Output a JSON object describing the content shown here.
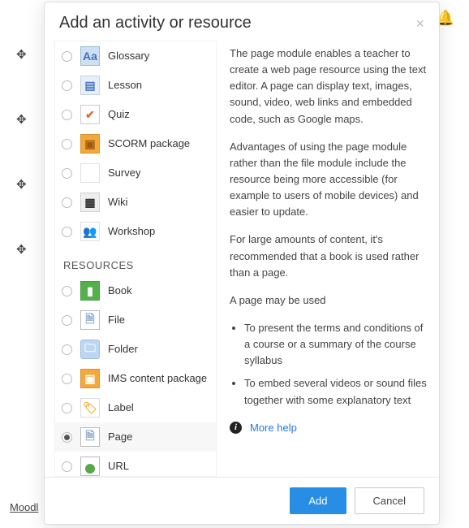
{
  "header": {
    "title": "Add an activity or resource"
  },
  "sections": {
    "activities_label": "",
    "resources_label": "RESOURCES"
  },
  "activities": [
    {
      "label": "Glossary",
      "icon": "glossary",
      "name": "activity-glossary"
    },
    {
      "label": "Lesson",
      "icon": "lesson",
      "name": "activity-lesson"
    },
    {
      "label": "Quiz",
      "icon": "quiz",
      "name": "activity-quiz"
    },
    {
      "label": "SCORM package",
      "icon": "scorm",
      "name": "activity-scorm"
    },
    {
      "label": "Survey",
      "icon": "survey",
      "name": "activity-survey"
    },
    {
      "label": "Wiki",
      "icon": "wiki",
      "name": "activity-wiki"
    },
    {
      "label": "Workshop",
      "icon": "workshop",
      "name": "activity-workshop"
    }
  ],
  "resources": [
    {
      "label": "Book",
      "icon": "book",
      "name": "resource-book"
    },
    {
      "label": "File",
      "icon": "file",
      "name": "resource-file"
    },
    {
      "label": "Folder",
      "icon": "folder",
      "name": "resource-folder"
    },
    {
      "label": "IMS content package",
      "icon": "ims",
      "name": "resource-ims"
    },
    {
      "label": "Label",
      "icon": "label-i",
      "name": "resource-label"
    },
    {
      "label": "Page",
      "icon": "page",
      "name": "resource-page",
      "selected": true
    },
    {
      "label": "URL",
      "icon": "url",
      "name": "resource-url"
    }
  ],
  "description": {
    "p1": "The page module enables a teacher to create a web page resource using the text editor. A page can display text, images, sound, video, web links and embedded code, such as Google maps.",
    "p2": "Advantages of using the page module rather than the file module include the resource being more accessible (for example to users of mobile devices) and easier to update.",
    "p3": "For large amounts of content, it's recommended that a book is used rather than a page.",
    "p4": "A page may be used",
    "bullets": [
      "To present the terms and conditions of a course or a summary of the course syllabus",
      "To embed several videos or sound files together with some explanatory text"
    ],
    "help": "More help"
  },
  "footer": {
    "add": "Add",
    "cancel": "Cancel"
  },
  "background": {
    "footer_link": "Moodl"
  }
}
